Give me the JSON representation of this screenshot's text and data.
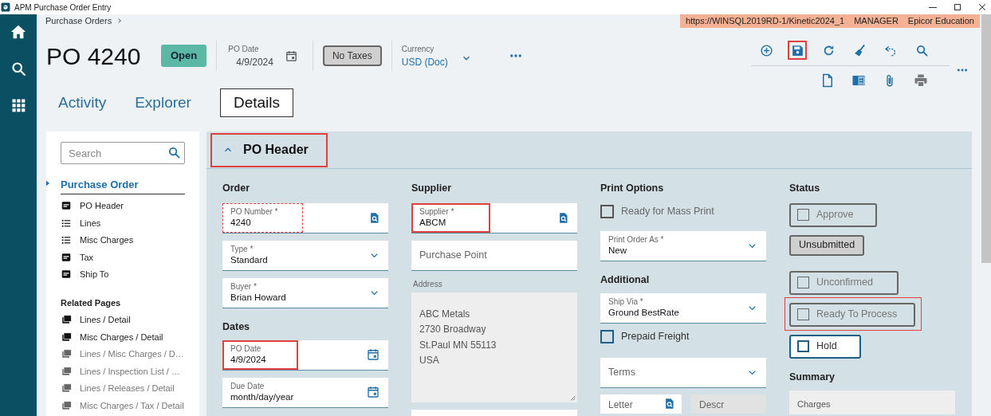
{
  "window": {
    "title": "APM Purchase Order Entry"
  },
  "breadcrumb": "Purchase Orders",
  "banner": [
    "https://WINSQL2019RD-1/Kinetic2024_1",
    "MANAGER",
    "Epicor Education"
  ],
  "header": {
    "title": "PO 4240",
    "status": "Open",
    "po_date": {
      "label": "PO Date",
      "value": "4/9/2024"
    },
    "tax_button": "No Taxes",
    "currency": {
      "label": "Currency",
      "value": "USD (Doc)"
    }
  },
  "toolbar": [
    {
      "highlighted": false
    },
    {
      "highlighted": true
    },
    {
      "highlighted": false
    },
    {
      "highlighted": false
    },
    {
      "highlighted": false
    },
    {
      "highlighted": false
    }
  ],
  "tabs": [
    {
      "label": "Activity",
      "selected": false
    },
    {
      "label": "Explorer",
      "selected": false
    },
    {
      "label": "Details",
      "selected": true
    }
  ],
  "sidebar": {
    "search_placeholder": "Search",
    "section": "Purchase Order",
    "items": [
      {
        "label": "PO Header",
        "kind": "card"
      },
      {
        "label": "Lines",
        "kind": "list"
      },
      {
        "label": "Misc Charges",
        "kind": "list"
      },
      {
        "label": "Tax",
        "kind": "card"
      },
      {
        "label": "Ship To",
        "kind": "card"
      }
    ],
    "related_title": "Related Pages",
    "related": [
      {
        "label": "Lines / Detail",
        "disabled": false
      },
      {
        "label": "Misc Charges / Detail",
        "disabled": false
      },
      {
        "label": "Lines / Misc Charges / D…",
        "disabled": true
      },
      {
        "label": "Lines / Inspection List / …",
        "disabled": true
      },
      {
        "label": "Lines / Releases / Detail",
        "disabled": true
      },
      {
        "label": "Misc Charges / Tax / Detail",
        "disabled": true
      }
    ]
  },
  "panel": {
    "title": "PO Header",
    "expanded": true,
    "highlighted": true,
    "columns": [
      [
        {
          "kind": "section",
          "text": "Order"
        },
        {
          "kind": "lookup",
          "label": "PO Number *",
          "value": "4240",
          "invalid": true
        },
        {
          "kind": "dropdown",
          "label": "Type *",
          "value": "Standard"
        },
        {
          "kind": "dropdown",
          "label": "Buyer *",
          "value": "Brian Howard"
        },
        {
          "kind": "section",
          "text": "Dates"
        },
        {
          "kind": "date",
          "label": "PO Date",
          "value": "4/9/2024",
          "highlighted": true
        },
        {
          "kind": "date",
          "label": "Due Date",
          "value": "month/day/year"
        }
      ],
      [
        {
          "kind": "section",
          "text": "Supplier"
        },
        {
          "kind": "lookup",
          "label": "Supplier *",
          "value": "ABCM",
          "highlighted": true
        },
        {
          "kind": "text",
          "placeholder": "Purchase Point"
        },
        {
          "kind": "address",
          "label": "Address",
          "lines": [
            "ABC Metals",
            "2730 Broadway",
            "St.Paul MN 55113",
            "USA"
          ]
        },
        {
          "kind": "text"
        }
      ],
      [
        {
          "kind": "section",
          "text": "Print Options"
        },
        {
          "kind": "checkbox",
          "label": "Ready for Mass Print",
          "checked": false,
          "disabled": true
        },
        {
          "kind": "dropdown",
          "label": "Print Order As *",
          "value": "New"
        },
        {
          "kind": "section",
          "text": "Additional"
        },
        {
          "kind": "dropdown",
          "label": "Ship Via *",
          "value": "Ground BestRate"
        },
        {
          "kind": "checkbox",
          "label": "Prepaid Freight",
          "checked": false,
          "disabled": false
        },
        {
          "kind": "dropdown",
          "placeholder": "Terms"
        },
        {
          "kind": "pair",
          "fields": [
            {
              "kind": "lookup",
              "placeholder": "Letter"
            },
            {
              "kind": "readonly",
              "placeholder": "Descr"
            }
          ]
        }
      ],
      [
        {
          "kind": "section",
          "text": "Status"
        },
        {
          "kind": "toggle",
          "label": "Approve",
          "checked": false,
          "disabled": true
        },
        {
          "kind": "button",
          "label": "Unsubmitted"
        },
        {
          "kind": "toggle",
          "label": "Unconfirmed",
          "checked": false,
          "disabled": true
        },
        {
          "kind": "toggle",
          "label": "Ready To Process",
          "checked": false,
          "disabled": true,
          "highlighted": true
        },
        {
          "kind": "toggle",
          "label": "Hold",
          "checked": false,
          "disabled": false
        },
        {
          "kind": "section",
          "text": "Summary"
        },
        {
          "kind": "summary",
          "label": "Charges"
        }
      ]
    ]
  }
}
